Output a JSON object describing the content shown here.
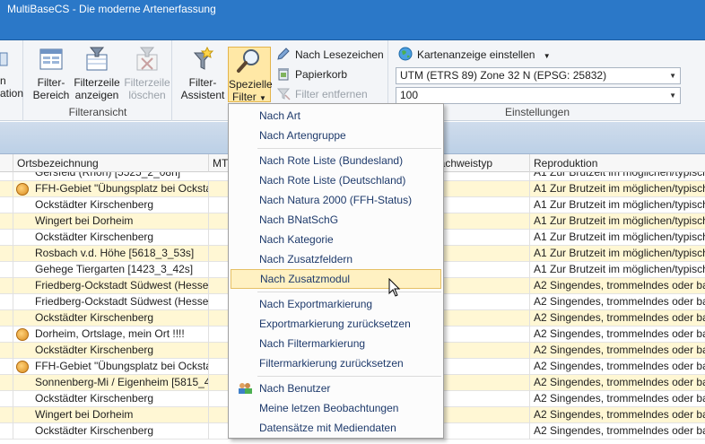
{
  "window": {
    "title": "MultiBaseCS - Die moderne Artenerfassung"
  },
  "ribbon": {
    "partial_left_label": "ation",
    "filteransicht": {
      "label": "Filteransicht",
      "buttons": [
        {
          "line1": "Filter-",
          "line2": "Bereich",
          "enabled": true
        },
        {
          "line1": "Filterzeile",
          "line2": "anzeigen",
          "enabled": true
        },
        {
          "line1": "Filterzeile",
          "line2": "löschen",
          "enabled": false
        }
      ]
    },
    "filter": {
      "assistent": {
        "line1": "Filter-",
        "line2": "Assistent"
      },
      "spezielle": {
        "line1": "Spezielle",
        "line2": "Filter"
      },
      "small": [
        {
          "label": "Nach Lesezeichen",
          "enabled": true,
          "icon": "pen-icon"
        },
        {
          "label": "Papierkorb",
          "enabled": true,
          "icon": "trash-icon"
        },
        {
          "label": "Filter entfernen",
          "enabled": false,
          "icon": "filter-remove-icon"
        }
      ]
    },
    "einstellungen": {
      "label": "Einstellungen",
      "map_button": "Kartenanzeige einstellen",
      "projection": "UTM (ETRS 89) Zone 32 N (EPSG: 25832)",
      "scale": "100"
    }
  },
  "grid": {
    "headers": {
      "ortsbezeichnung": "Ortsbezeichnung",
      "mtb": "MTB",
      "nachweistyp": "Nachweistyp",
      "reproduktion": "Reproduktion"
    },
    "cut_row": {
      "ort": "Gersfeld (Rhön) [5525_2_08n]",
      "repro": "A1 Zur Brutzeit im möglichen/typisch"
    },
    "rows": [
      {
        "ort": "FFH-Gebiet \"Übungsplatz bei Ocksta",
        "repro": "A1 Zur Brutzeit im möglichen/typisch",
        "icon": true
      },
      {
        "ort": "Ockstädter Kirschenberg",
        "repro": "A1 Zur Brutzeit im möglichen/typisch",
        "icon": false
      },
      {
        "ort": "Wingert bei Dorheim",
        "repro": "A1 Zur Brutzeit im möglichen/typisch",
        "icon": false
      },
      {
        "ort": "Ockstädter Kirschenberg",
        "repro": "A1 Zur Brutzeit im möglichen/typisch",
        "icon": false
      },
      {
        "ort": "Rosbach v.d. Höhe [5618_3_53s]",
        "repro": "A1 Zur Brutzeit im möglichen/typisch",
        "icon": false
      },
      {
        "ort": "Gehege Tiergarten [1423_3_42s]",
        "repro": "A1 Zur Brutzeit im möglichen/typisch",
        "icon": false
      },
      {
        "ort": "Friedberg-Ockstadt Südwest (Hesse",
        "repro": "A2 Singendes, trommelndes oder bal",
        "icon": false
      },
      {
        "ort": "Friedberg-Ockstadt Südwest (Hesse",
        "repro": "A2 Singendes, trommelndes oder bal",
        "icon": false
      },
      {
        "ort": "Ockstädter Kirschenberg",
        "repro": "A2 Singendes, trommelndes oder bal",
        "icon": false
      },
      {
        "ort": "Dorheim, Ortslage, mein Ort !!!!",
        "repro": "A2 Singendes, trommelndes oder bal",
        "icon": true
      },
      {
        "ort": "Ockstädter Kirschenberg",
        "repro": "A2 Singendes, trommelndes oder bal",
        "icon": false
      },
      {
        "ort": "FFH-Gebiet \"Übungsplatz bei Ocksta",
        "repro": "A2 Singendes, trommelndes oder bal",
        "icon": true
      },
      {
        "ort": "Sonnenberg-Mi / Eigenheim [5815_4",
        "repro": "A2 Singendes, trommelndes oder bal",
        "icon": false
      },
      {
        "ort": "Ockstädter Kirschenberg",
        "repro": "A2 Singendes, trommelndes oder bal",
        "icon": false
      },
      {
        "ort": "Wingert bei Dorheim",
        "repro": "A2 Singendes, trommelndes oder bal",
        "icon": false
      },
      {
        "ort": "Ockstädter Kirschenberg",
        "repro": "A2 Singendes, trommelndes oder bal",
        "icon": false
      }
    ]
  },
  "menu": {
    "items": [
      {
        "label": "Nach Art"
      },
      {
        "label": "Nach Artengruppe"
      },
      {
        "label": "Nach Rote Liste (Bundesland)"
      },
      {
        "label": "Nach Rote Liste (Deutschland)"
      },
      {
        "label": "Nach Natura 2000 (FFH-Status)"
      },
      {
        "label": "Nach BNatSchG"
      },
      {
        "label": "Nach Kategorie"
      },
      {
        "label": "Nach Zusatzfeldern"
      },
      {
        "label": "Nach Zusatzmodul"
      },
      {
        "label": "Nach Exportmarkierung"
      },
      {
        "label": "Exportmarkierung zurücksetzen"
      },
      {
        "label": "Nach Filtermarkierung"
      },
      {
        "label": "Filtermarkierung zurücksetzen"
      },
      {
        "label": "Nach Benutzer",
        "icon": "users-icon"
      },
      {
        "label": "Meine letzen Beobachtungen"
      },
      {
        "label": "Datensätze mit Mediendaten"
      }
    ],
    "hovered_index": 8
  },
  "colors": {
    "titlebar": "#2b78c8",
    "row_alt": "#fff7d4",
    "menu_hover": "#fff1c2",
    "menu_text": "#1e3a6b"
  }
}
